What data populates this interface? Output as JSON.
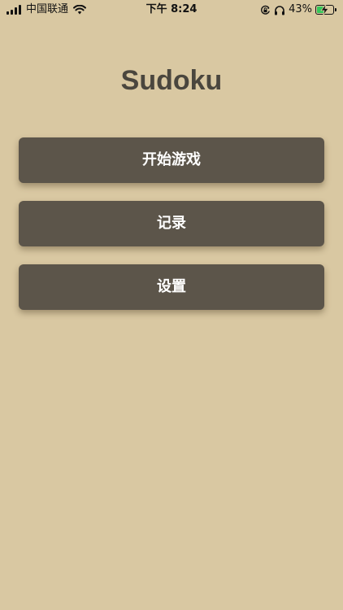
{
  "status_bar": {
    "carrier": "中国联通",
    "time": "下午 8:24",
    "battery_percent": "43%",
    "battery_level": 0.43,
    "icons": [
      "signal-bars-icon",
      "wifi-icon",
      "orientation-lock-icon",
      "headphones-icon",
      "battery-charging-icon"
    ]
  },
  "app": {
    "title": "Sudoku"
  },
  "menu": {
    "start_game": "开始游戏",
    "records": "记录",
    "settings": "设置"
  },
  "colors": {
    "background": "#d9c8a2",
    "button": "#5c554a",
    "title": "#4a463e",
    "battery_fill": "#34c759"
  }
}
